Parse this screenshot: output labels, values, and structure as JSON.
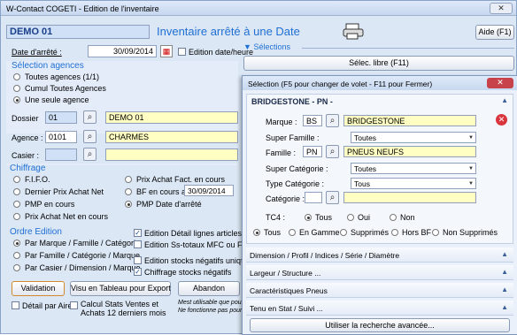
{
  "window": {
    "title": "W-Contact COGETI - Edition de l'inventaire",
    "close": "✕"
  },
  "top": {
    "code": "DEMO 01",
    "title": "Inventaire arrêté à une Date",
    "aide": "Aide (F1)"
  },
  "date": {
    "label": "Date d'arrêté :",
    "value": "30/09/2014",
    "edition_label": "Edition date/heure"
  },
  "selections": {
    "label": "Sélections",
    "libre": "Sélec. libre (F11)"
  },
  "agences": {
    "header": "Sélection agences",
    "options": [
      "Toutes agences (1/1)",
      "Cumul Toutes Agences",
      "Une seule agence"
    ],
    "selected": 2
  },
  "fields": {
    "dossier_label": "Dossier",
    "dossier_code": "01",
    "dossier_name": "DEMO 01",
    "agence_label": "Agence :",
    "agence_code": "0101",
    "agence_name": "CHARMES",
    "casier_label": "Casier :"
  },
  "chiffrage": {
    "header": "Chiffrage",
    "left": [
      "F.I.F.O.",
      "Dernier Prix Achat Net",
      "PMP en cours",
      "Prix Achat Net en cours"
    ],
    "right": [
      "Prix Achat Fact. en cours",
      "BF en cours au",
      "PMP Date d'arrêté"
    ],
    "bf_date": "30/09/2014",
    "selected_right": 2
  },
  "ordre": {
    "header": "Ordre Edition",
    "options": [
      "Par Marque / Famille / Catégorie",
      "Par Famille / Catégorie / Marque",
      "Par Casier / Dimension / Marque"
    ],
    "selected": 0
  },
  "checks": {
    "detail_lignes": "Edition Détail lignes articles",
    "stotaux": "Edition Ss-totaux MFC ou FCM",
    "negatifs_uniq": "Edition stocks négatifs uniqt",
    "chiffrage_neg": "Chiffrage stocks négatifs",
    "detail_aire": "Détail par Aire",
    "calcul_stats_1": "Calcul Stats Ventes et",
    "calcul_stats_2": "Achats 12 derniers mois"
  },
  "buttons": {
    "validation": "Validation",
    "tableau": "Visu en Tableau pour Export",
    "abandon": "Abandon"
  },
  "note": {
    "line1": "Mest utilisable que pour",
    "line2": "Ne fonctionne pas pour c"
  },
  "panel": {
    "title": "Sélection (F5 pour changer de volet - F11 pour Fermer)",
    "close": "✕",
    "section_title": "BRIDGESTONE - PN -",
    "marque_label": "Marque :",
    "marque_code": "BS",
    "marque_name": "BRIDGESTONE",
    "superfam_label": "Super Famille :",
    "superfam_value": "Toutes",
    "famille_label": "Famille :",
    "famille_code": "PN",
    "famille_name": "PNEUS NEUFS",
    "supercat_label": "Super Catégorie :",
    "supercat_value": "Toutes",
    "typecat_label": "Type Catégorie :",
    "typecat_value": "Tous",
    "categorie_label": "Catégorie :",
    "tc4_label": "TC4 :",
    "tc4_options": [
      "Tous",
      "Oui",
      "Non"
    ],
    "gamme_options": [
      "Tous",
      "En Gamme",
      "Supprimés",
      "Hors BF",
      "Non Supprimés"
    ],
    "sections": [
      "Dimension / Profil / Indices / Série / Diamètre",
      "Largeur / Structure ...",
      "Caractéristiques Pneus",
      "Tenu en Stat / Suivi ..."
    ],
    "advanced": "Utiliser la recherche avancée..."
  }
}
